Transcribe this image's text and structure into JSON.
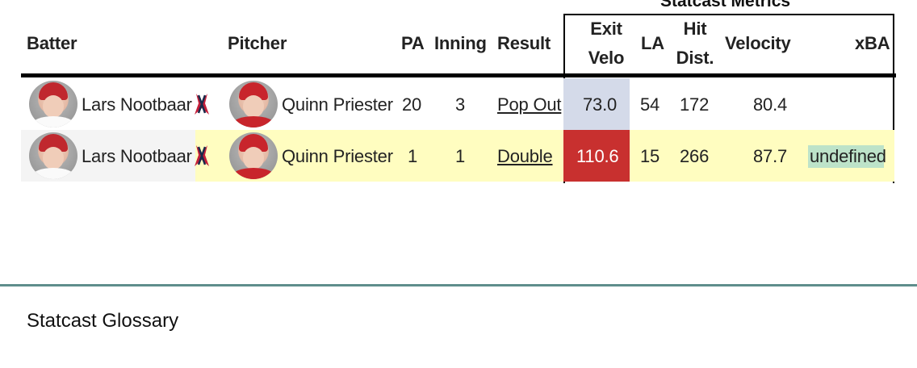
{
  "table": {
    "group_header": "Statcast Metrics",
    "columns": {
      "batter": "Batter",
      "pitcher": "Pitcher",
      "pa": "PA",
      "inning": "Inning",
      "result": "Result",
      "exit_velo_1": "Exit",
      "exit_velo_2": "Velo",
      "la": "LA",
      "hit_dist_1": "Hit",
      "hit_dist_2": "Dist.",
      "velocity": "Velocity",
      "xba": "xBA"
    },
    "rows": [
      {
        "batter": "Lars Nootbaar",
        "pitcher": "Quinn Priester",
        "pa": "20",
        "inning": "3",
        "result": "Pop Out",
        "exit_velo": "73.0",
        "la": "54",
        "hit_dist": "172",
        "velocity": "80.4",
        "xba": ""
      },
      {
        "batter": "Lars Nootbaar",
        "pitcher": "Quinn Priester",
        "pa": "1",
        "inning": "1",
        "result": "Double",
        "exit_velo": "110.6",
        "la": "15",
        "hit_dist": "266",
        "velocity": "87.7",
        "xba": "undefined"
      }
    ]
  },
  "colors": {
    "exit_velo_low": "#d4dae9",
    "exit_velo_high": "#c8302f",
    "row_highlight": "#fffdc0",
    "xba_highlight": "#bde3c9",
    "divider": "#5f8e8c"
  },
  "icons": {
    "team_logo": "cardinals-logo-icon",
    "avatar": "player-headshot"
  },
  "footer": {
    "glossary_title": "Statcast Glossary"
  }
}
